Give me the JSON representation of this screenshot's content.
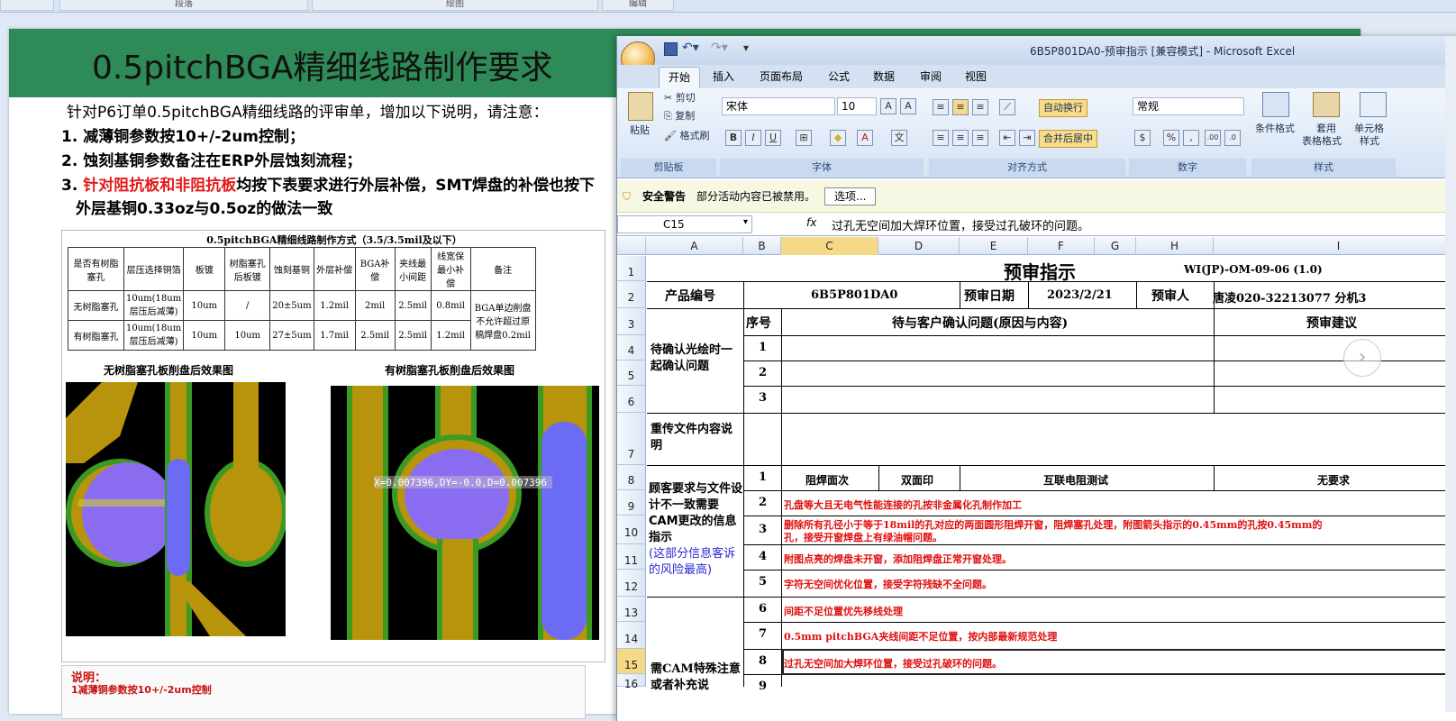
{
  "ppt": {
    "ribbon_groups": [
      "段落",
      "绘图",
      "编辑"
    ],
    "slide": {
      "title": "0.5pitchBGA精细线路制作要求",
      "intro": "针对P6订单0.5pitchBGA精细线路的评审单，增加以下说明，请注意：",
      "item1": "1. 减薄铜参数按10+/-2um控制；",
      "item2": "2. 蚀刻基铜参数备注在ERP外层蚀刻流程；",
      "item3_prefix": "3. ",
      "item3_red": "针对阻抗板和非阻抗板",
      "item3_rest": "均按下表要求进行外层补偿，SMT焊盘的补偿也按下",
      "item3_line2": "外层基铜0.33oz与0.5oz的做法一致",
      "note_title": "说明：",
      "note_line1": "1减薄铜参数按10+/-2um控制"
    },
    "embedded": {
      "title": "0.5pitchBGA精细线路制作方式（3.5/3.5mil及以下）",
      "headers": [
        "是否有树脂塞孔",
        "层压选择铜箔",
        "板镀",
        "树脂塞孔后板镀",
        "蚀刻基铜",
        "外层补偿",
        "BGA补偿",
        "夹线最小间距",
        "线宽保最小补偿",
        "备注"
      ],
      "rows": [
        [
          "无树脂塞孔",
          "10um(18um层压后减薄)",
          "10um",
          "/",
          "20±5um",
          "1.2mil",
          "2mil",
          "2.5mil",
          "0.8mil"
        ],
        [
          "有树脂塞孔",
          "10um(18um层压后减薄)",
          "10um",
          "10um",
          "27±5um",
          "1.7mil",
          "2.5mil",
          "2.5mil",
          "1.2mil"
        ]
      ],
      "remark": "BGA单边削盘不允许超过原稿焊盘0.2mil",
      "caption_left": "无树脂塞孔板削盘后效果图",
      "caption_right": "有树脂塞孔板削盘后效果图",
      "measure_text": "X=0.007396,DY=-0.0,D=0.007396"
    }
  },
  "excel": {
    "window_title": "6B5P801DA0-预审指示  [兼容模式] - Microsoft Excel",
    "qat": [
      "save-icon",
      "undo-icon",
      "redo-icon"
    ],
    "tabs": [
      "开始",
      "插入",
      "页面布局",
      "公式",
      "数据",
      "审阅",
      "视图"
    ],
    "active_tab": "开始",
    "clipboard": {
      "paste": "粘贴",
      "cut": "剪切",
      "copy": "复制",
      "format_painter": "格式刷",
      "label": "剪贴板"
    },
    "font": {
      "name": "宋体",
      "size": "10",
      "bold": "B",
      "italic": "I",
      "underline": "U",
      "label": "字体",
      "wen": "文"
    },
    "alignment": {
      "wrap": "自动换行",
      "merge": "合并后居中",
      "label": "对齐方式"
    },
    "number": {
      "format": "常规",
      "percent": "%",
      "comma": ",",
      "inc": ".00",
      "dec": ".0",
      "label": "数字"
    },
    "styles": {
      "conditional": "条件格式",
      "table": "套用",
      "table2": "表格格式",
      "cell": "单元格",
      "cell2": "样式",
      "label": "样式"
    },
    "security": {
      "label": "安全警告",
      "message": "部分活动内容已被禁用。",
      "options": "选项..."
    },
    "namebox": "C15",
    "fx": "fx",
    "formula": "过孔无空间加大焊环位置，接受过孔破环的问题。",
    "columns": [
      "A",
      "B",
      "C",
      "D",
      "E",
      "F",
      "G",
      "H",
      "I"
    ],
    "rows": [
      "1",
      "2",
      "3",
      "4",
      "5",
      "6",
      "7",
      "8",
      "9",
      "10",
      "11",
      "12",
      "13",
      "14",
      "15",
      "16"
    ],
    "sheet": {
      "title": "预审指示",
      "doc_no": "WI(JP)-OM-09-06 (1.0)",
      "product_label": "产品编号",
      "product_value": "6B5P801DA0",
      "date_label": "预审日期",
      "date_value": "2023/2/21",
      "reviewer_label": "预审人",
      "reviewer_value": "唐凌020-32213077 分机3",
      "seq_label": "序号",
      "issue_label": "待与客户确认问题(原因与内容)",
      "advice_label": "预审建议",
      "group1": "待确认光绘时一起确认问题",
      "group2": "重传文件内容说明",
      "group3": "顾客要求与文件设计不一致需要CAM更改的信息指示",
      "group3_blue": "(这部分信息客诉的风险最高)",
      "group4": "需CAM特殊注意或者补充说",
      "seq": [
        "1",
        "2",
        "3",
        "1",
        "2",
        "3",
        "4",
        "5",
        "6",
        "7",
        "8",
        "9"
      ],
      "r8": [
        "阻焊面次",
        "双面印",
        "互联电阻测试",
        "无要求"
      ],
      "r9": "孔盘等大且无电气性能连接的孔按非金属化孔制作加工",
      "r10a": "删除所有孔径小于等于18mil的孔对应的两面圆形阻焊开窗，阻焊塞孔处理，附图箭头指示的0.45mm的孔按0.45mm的",
      "r10b": "孔，接受开窗焊盘上有绿油帽问题。",
      "r11": "附图点亮的焊盘未开窗，添加阻焊盘正常开窗处理。",
      "r12": "字符无空间优化位置，接受字符残缺不全问题。",
      "r13": "间距不足位置优先移线处理",
      "r14": "0.5mm pitchBGA夹线间距不足位置，按内部最新规范处理",
      "r15": "过孔无空间加大焊环位置，接受过孔破环的问题。"
    }
  },
  "colors": {
    "slide_header": "#2e8a57",
    "accent_red": "#e21b1b",
    "excel_blue": "#d3e1f3"
  }
}
